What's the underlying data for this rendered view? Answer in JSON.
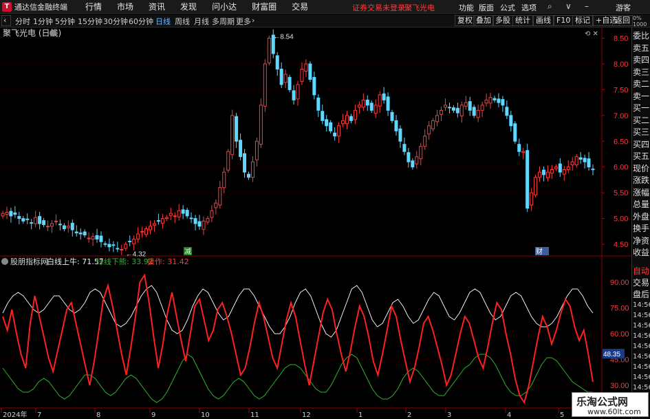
{
  "app": {
    "title": "通达信金融终端",
    "logo_glyph": "T"
  },
  "menu": [
    "行情",
    "市场",
    "资讯",
    "发现",
    "问小达",
    "财富圈",
    "交易"
  ],
  "status": {
    "security": "证券交易未登录",
    "stock_name": "聚飞光电"
  },
  "right_menu": [
    "功能",
    "版面",
    "公式",
    "选项"
  ],
  "user": "游客",
  "periods": [
    "分时",
    "1分钟",
    "5分钟",
    "15分钟",
    "30分钟",
    "60分钟",
    "日线",
    "周线",
    "月线",
    "多周期",
    "更多"
  ],
  "active_period": "日线",
  "tool_buttons": [
    "复权",
    "叠加",
    "多股",
    "统计",
    "画线",
    "F10",
    "标记",
    "+自选",
    "返回"
  ],
  "chart_title": "聚飞光电 (日线)",
  "indicator": {
    "name": "股朋指标网",
    "white_label": "白线上牛: 71.57",
    "green_label": "绿线下熊: 33.92",
    "red_label": "操作: 31.42"
  },
  "side_panel": {
    "header": "0%\n1000",
    "items": [
      "委比",
      "卖五",
      "卖四",
      "卖三",
      "卖二",
      "卖一",
      "买一",
      "买二",
      "买三",
      "买四",
      "买五",
      "现价",
      "涨跌",
      "涨幅",
      "总量",
      "外盘",
      "换手",
      "净资",
      "收益"
    ],
    "lower_items": [
      "自动",
      "交易",
      "盘后"
    ],
    "times": [
      "14:56",
      "14:56",
      "14:56",
      "14:56",
      "14:56",
      "14:56",
      "14:56",
      "14:56",
      "14:56"
    ],
    "current_value": "48.35"
  },
  "markers": {
    "reduce": "减",
    "finance": "财"
  },
  "watermark": {
    "title": "乐淘公式网",
    "url": "www.60lt.com"
  },
  "chart_data": [
    {
      "type": "candlestick",
      "title": "聚飞光电 (日线)",
      "y_ticks": [
        "8.50",
        "8.00",
        "7.50",
        "7.00",
        "6.50",
        "6.00",
        "5.50",
        "5.00",
        "4.50"
      ],
      "ylim": [
        4.3,
        8.6
      ],
      "annotations": [
        {
          "label": "8.54",
          "value": 8.54
        },
        {
          "label": "4.32",
          "value": 4.32
        }
      ],
      "x_ticks": [
        "2024年",
        "7",
        "8",
        "9",
        "10",
        "11",
        "12",
        "1",
        "2",
        "3",
        "4",
        "5"
      ],
      "closes": [
        5.1,
        5.12,
        5.05,
        5.08,
        5.0,
        4.95,
        4.98,
        4.92,
        5.02,
        4.9,
        4.88,
        4.85,
        4.9,
        4.95,
        4.88,
        4.8,
        4.85,
        4.78,
        4.72,
        4.7,
        4.68,
        4.62,
        4.65,
        4.6,
        4.55,
        4.5,
        4.45,
        4.48,
        4.42,
        4.4,
        4.5,
        4.55,
        4.6,
        4.7,
        4.75,
        4.8,
        4.85,
        4.9,
        4.95,
        5.0,
        5.02,
        5.1,
        5.05,
        5.15,
        5.1,
        5.05,
        5.0,
        4.9,
        4.85,
        4.95,
        5.0,
        5.15,
        5.3,
        5.6,
        5.9,
        6.3,
        7.0,
        6.5,
        6.2,
        5.9,
        5.8,
        6.1,
        6.5,
        7.2,
        8.0,
        8.5,
        8.2,
        7.9,
        7.6,
        7.8,
        7.5,
        7.3,
        7.6,
        7.9,
        8.0,
        7.7,
        7.4,
        7.1,
        6.9,
        6.8,
        6.7,
        6.6,
        6.8,
        6.9,
        7.0,
        6.9,
        7.1,
        7.2,
        7.3,
        7.2,
        7.1,
        7.2,
        7.4,
        7.3,
        7.1,
        6.9,
        6.7,
        6.5,
        6.3,
        6.1,
        6.0,
        6.2,
        6.4,
        6.6,
        6.8,
        6.9,
        7.0,
        7.1,
        7.2,
        7.15,
        7.1,
        7.05,
        7.2,
        7.25,
        7.1,
        7.0,
        7.1,
        7.2,
        7.3,
        7.35,
        7.3,
        7.25,
        7.2,
        7.0,
        6.8,
        6.5,
        6.3,
        6.3,
        5.2,
        5.5,
        5.8,
        5.9,
        5.85,
        5.9,
        5.95,
        6.0,
        5.9,
        5.95,
        6.0,
        6.1,
        6.2,
        6.15,
        6.1,
        6.0,
        5.95
      ]
    },
    {
      "type": "line",
      "title": "股朋指标网",
      "y_ticks": [
        "90.00",
        "75.00",
        "60.00",
        "45.00",
        "30.00"
      ],
      "ylim": [
        18,
        100
      ],
      "series": [
        {
          "name": "白线上牛",
          "color": "#f0f0f0",
          "values": [
            72,
            78,
            82,
            84,
            82,
            78,
            74,
            72,
            74,
            78,
            82,
            82,
            78,
            74,
            72,
            74,
            78,
            84,
            86,
            84,
            78,
            72,
            66,
            64,
            66,
            70,
            76,
            82,
            86,
            88,
            84,
            76,
            68,
            62,
            60,
            62,
            68,
            76,
            82,
            86,
            84,
            78,
            72,
            68,
            70,
            76,
            82,
            86,
            86,
            82,
            76,
            70,
            64,
            60,
            60,
            64,
            70,
            78,
            84,
            86,
            82,
            74,
            66,
            60,
            58,
            62,
            70,
            78,
            86,
            88,
            84,
            76,
            68,
            64,
            66,
            72,
            78,
            80,
            76,
            70,
            66,
            68,
            74,
            80,
            84,
            82,
            76,
            70,
            68,
            72,
            78,
            84,
            86,
            84,
            78,
            72,
            68,
            70,
            76,
            82,
            84,
            82,
            76,
            70,
            66,
            64,
            64,
            66,
            70,
            76,
            82,
            86,
            86,
            82,
            76,
            72
          ]
        },
        {
          "name": "绿线下熊",
          "color": "#2fb52f",
          "values": [
            40,
            36,
            32,
            28,
            26,
            26,
            28,
            32,
            34,
            32,
            28,
            24,
            22,
            24,
            28,
            32,
            36,
            36,
            34,
            30,
            26,
            24,
            26,
            30,
            34,
            36,
            34,
            30,
            26,
            22,
            20,
            22,
            26,
            32,
            38,
            44,
            48,
            46,
            40,
            34,
            28,
            24,
            22,
            24,
            28,
            32,
            34,
            32,
            28,
            24,
            22,
            24,
            28,
            32,
            36,
            40,
            42,
            42,
            40,
            36,
            32,
            28,
            26,
            26,
            30,
            36,
            42,
            46,
            48,
            46,
            40,
            34,
            28,
            24,
            22,
            22,
            24,
            28,
            34,
            38,
            40,
            38,
            34,
            30,
            26,
            24,
            24,
            28,
            32,
            36,
            40,
            42,
            46,
            48,
            48,
            46,
            42,
            36,
            30,
            26,
            24,
            24,
            26,
            30,
            36,
            42,
            46,
            46,
            44,
            40,
            36,
            32,
            30,
            28,
            26,
            26
          ]
        },
        {
          "name": "操作",
          "color": "#ff2020",
          "values": [
            70,
            62,
            74,
            60,
            48,
            40,
            66,
            82,
            70,
            58,
            46,
            38,
            50,
            62,
            74,
            78,
            66,
            54,
            42,
            30,
            44,
            62,
            80,
            88,
            76,
            62,
            48,
            36,
            52,
            70,
            90,
            94,
            78,
            58,
            40,
            54,
            72,
            84,
            70,
            56,
            44,
            60,
            76,
            80,
            68,
            56,
            62,
            74,
            78,
            70,
            60,
            48,
            36,
            40,
            52,
            66,
            78,
            70,
            58,
            46,
            40,
            54,
            68,
            78,
            70,
            56,
            42,
            30,
            44,
            58,
            72,
            80,
            74,
            60,
            48,
            38,
            50,
            64,
            76,
            70,
            58,
            44,
            36,
            48,
            62,
            76,
            70,
            56,
            44,
            32,
            40,
            52,
            66,
            70,
            62,
            52,
            42,
            30,
            36,
            48,
            60,
            70,
            66,
            56,
            46,
            40,
            52,
            66,
            78,
            74,
            60,
            48,
            34,
            24,
            20,
            30,
            44,
            58,
            70,
            64,
            54,
            62,
            72,
            80,
            76,
            64,
            56,
            62,
            48,
            32
          ]
        }
      ],
      "current_value": 48.35
    }
  ]
}
